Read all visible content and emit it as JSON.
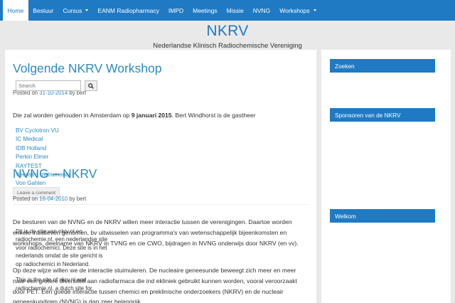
{
  "nav": {
    "items": [
      {
        "label": "Home",
        "active": true,
        "dropdown": false
      },
      {
        "label": "Bestuur",
        "dropdown": false
      },
      {
        "label": "Cursus",
        "dropdown": true
      },
      {
        "label": "EANM Radiopharmacy",
        "dropdown": false
      },
      {
        "label": "IMPD",
        "dropdown": false
      },
      {
        "label": "Meetings",
        "dropdown": false
      },
      {
        "label": "Missie",
        "dropdown": false
      },
      {
        "label": "NVNG",
        "dropdown": false
      },
      {
        "label": "Workshops",
        "dropdown": true
      }
    ]
  },
  "site": {
    "title": "NKRV",
    "tagline": "Nederlandse Klinisch Radiochemische Vereniging"
  },
  "posts": [
    {
      "title": "Volgende NKRV Workshop",
      "posted_on": "Posted on",
      "date": "31-10-2014",
      "by": "by",
      "author": "bert",
      "body_before": "Die zal worden gehouden in Amsterdam op ",
      "body_bold": "9 januari 2015",
      "body_after": ". Bert Windhorst is de gastheer",
      "comment_label": "Leave a comment"
    },
    {
      "title": "NVNG – NKRV",
      "posted_on": "Posted on",
      "date": "16-04-2010",
      "by": "by",
      "author": "bert",
      "paragraphs": [
        "De besturen van de NVNG en de NKRV willen meer interactie tussen de verenigingen. Daartoe worden enkele intiatieven genomen, bv uitwisselen van programma's van wetenschappelijk bijeenkomsten en workshops, deelname van NKRV in TVNG en cie CWO, bijdragen in NVNG onderwijs door NKRV (en vv).",
        "Op deze wijze willen we de interactie stuimuleren. De nucleaire geneesunde beweegt zich meer en meer naar een grotere diversiteit aan radiofarmaca die ind ekliniek gebruikt kunnen worden, vooral veroorzaakt door PET. Een goede interactie tussen chemici en preklinische onderzoekers (NKRV) en de nucleair geneeskundigen (NVNG) is dan zeer belangrijk."
      ]
    }
  ],
  "sidebar": {
    "search": {
      "heading": "Zoeken",
      "placeholder": "Search",
      "button_icon": "search-icon"
    },
    "sponsors": {
      "heading": "Sponsoren van de NKRV",
      "items": [
        "BV Cyclotron VU",
        "IC Medical",
        "IDB Holland",
        "Perkin Elmer",
        "RAYTEST",
        "Veenstra Instruments",
        "Von Gahlen"
      ]
    },
    "welcome": {
      "heading": "Welkom",
      "paragraphs": [
        "Dit is de site van nkrv.nl en radiochemie.nl, een nederlandse site voor radiochemici. Deze site is in het nederlands omdat de site gericht is op radiochemici in Nederland.",
        "This is the site of nkrv.nl and radiochemie.nl, a dutch site for"
      ]
    }
  },
  "colors": {
    "brand": "#1f7ac3",
    "link": "#2b8bc2",
    "page_bg": "#e9e9e9"
  }
}
